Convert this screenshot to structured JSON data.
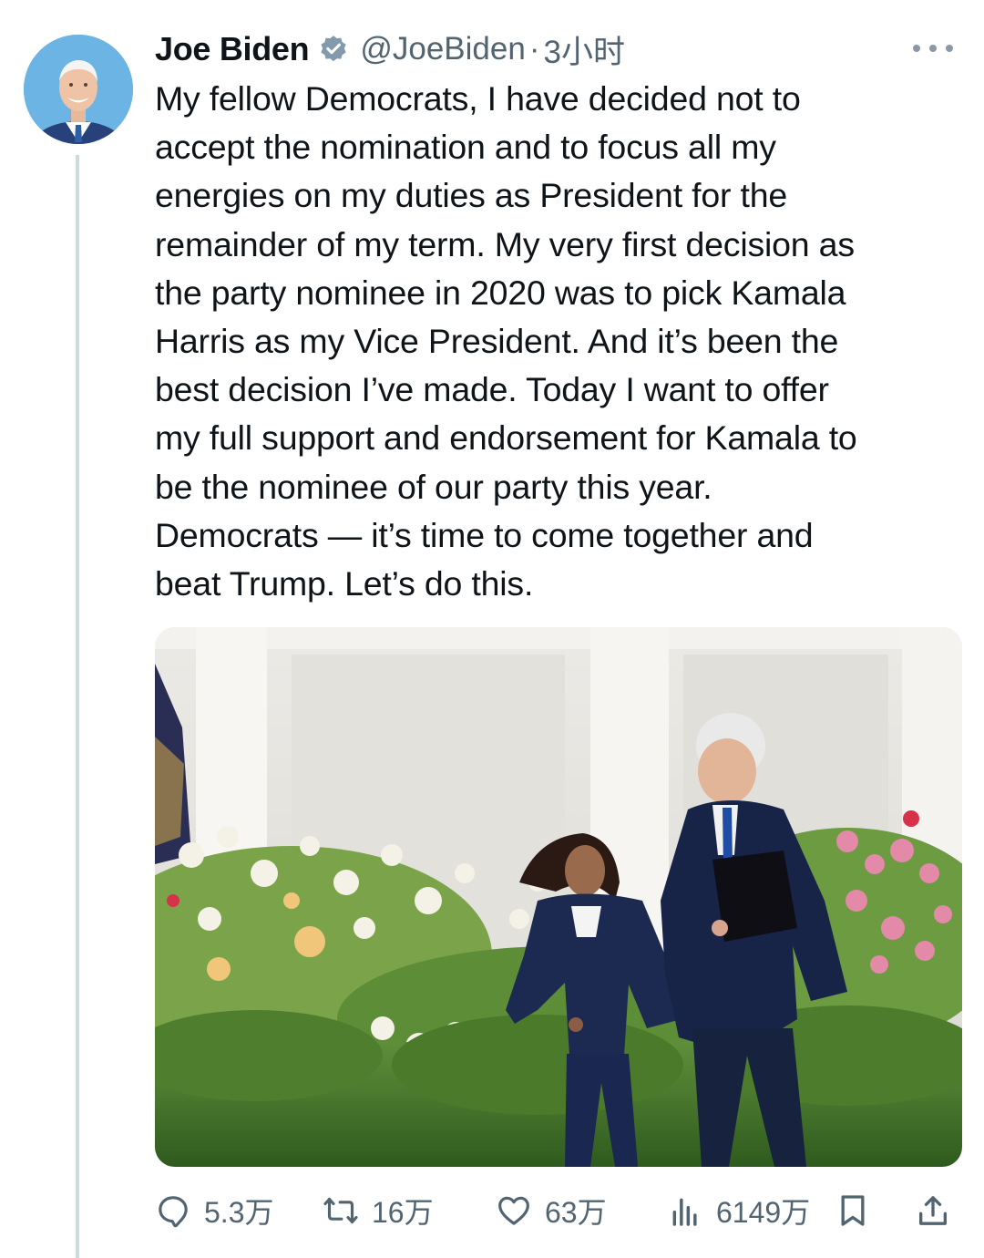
{
  "tweet": {
    "author": {
      "display_name": "Joe Biden",
      "handle": "@JoeBiden",
      "verified": true,
      "avatar_icon": "profile-photo"
    },
    "separator": "·",
    "time": "3小时",
    "text": "My fellow Democrats, I have decided not to\naccept the nomination and to focus all my\nenergies on my duties as President for the\nremainder of my term. My very first decision as\nthe party nominee in 2020 was to pick Kamala\nHarris as my Vice President. And it’s been the\nbest decision I’ve made. Today I want to offer\nmy full support and endorsement for Kamala to\nbe the nominee of our party this year.\nDemocrats — it’s time to come together and\nbeat Trump. Let’s do this.",
    "media": {
      "type": "photo"
    },
    "actions": {
      "replies": "5.3万",
      "retweets": "16万",
      "likes": "63万",
      "views": "6149万"
    }
  },
  "icons": {
    "more": "more-dots-icon",
    "verified": "verified-badge-icon",
    "reply": "reply-icon",
    "retweet": "retweet-icon",
    "like": "heart-icon",
    "views": "views-chart-icon",
    "bookmark": "bookmark-icon",
    "share": "share-icon"
  },
  "colors": {
    "text": "#0f1419",
    "secondary": "#536471",
    "thread_line": "#cfd9de"
  }
}
